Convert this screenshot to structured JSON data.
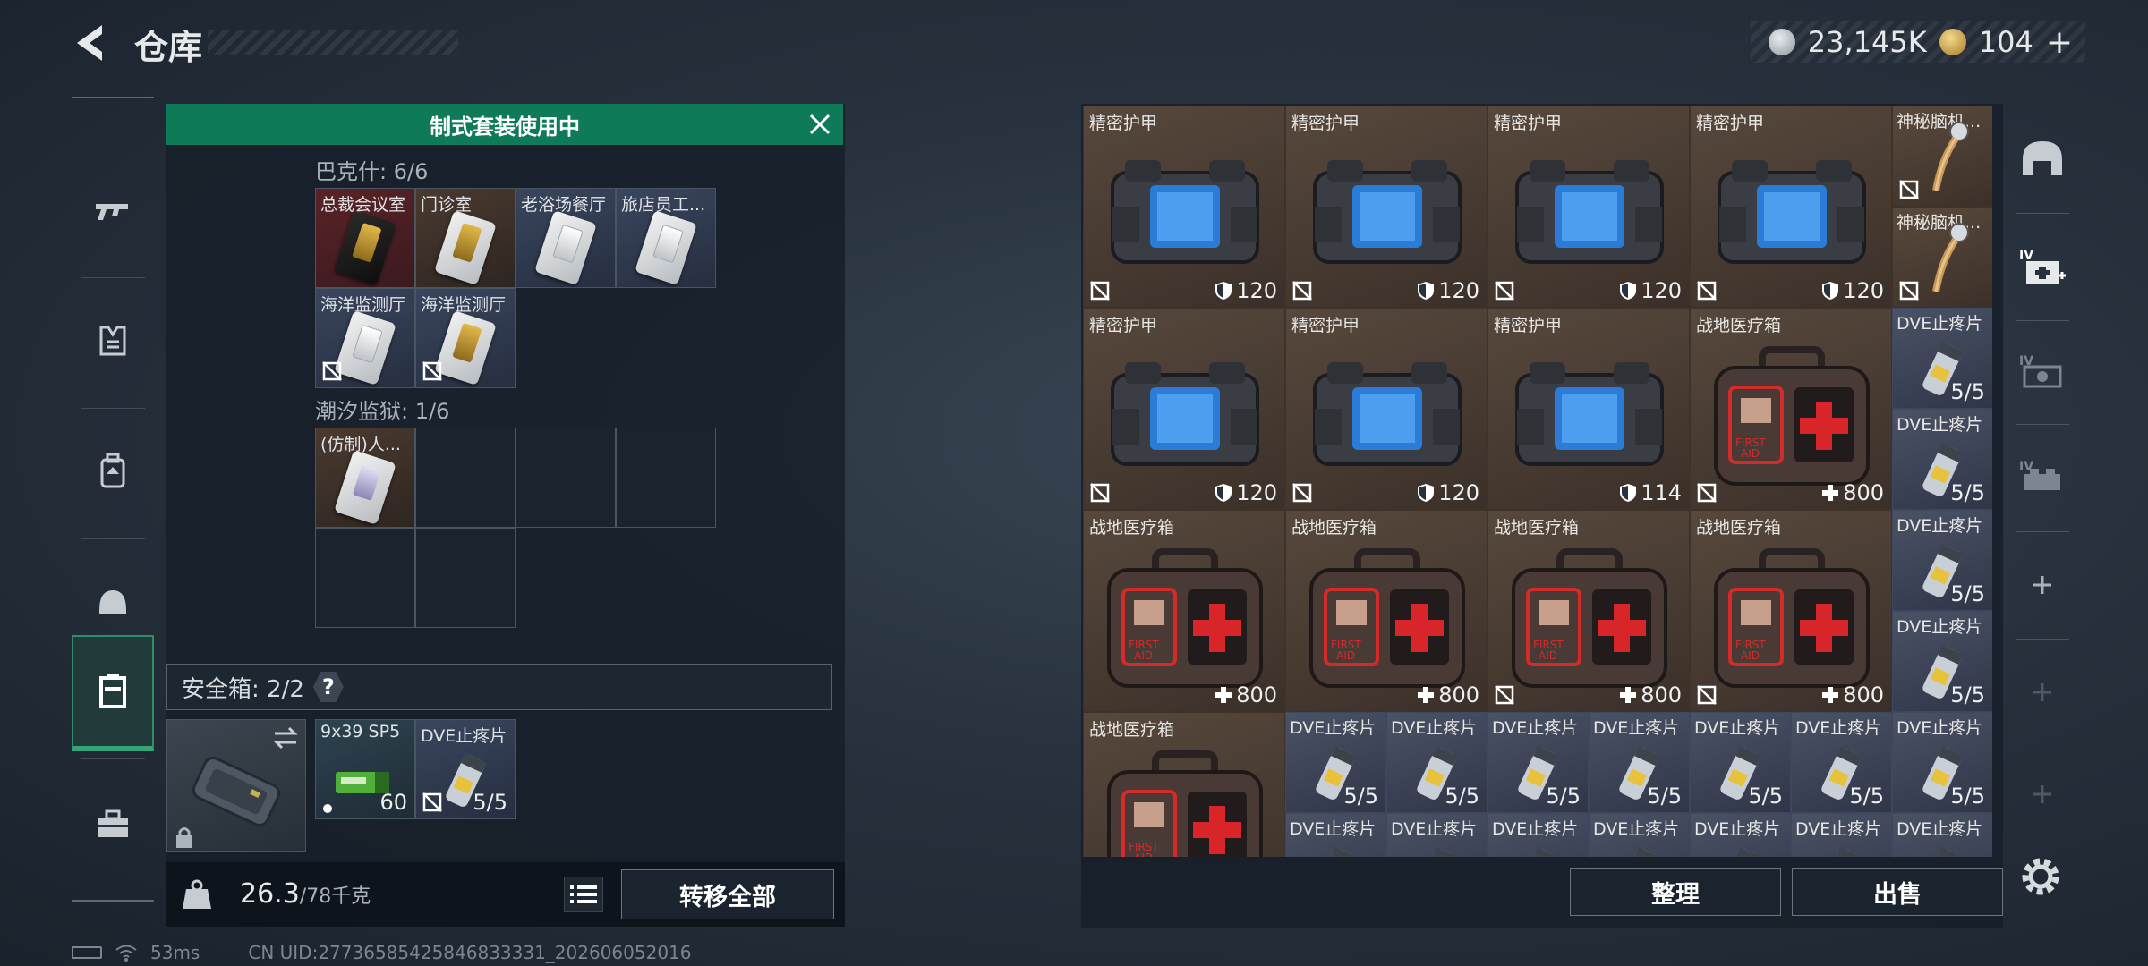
{
  "header": {
    "title": "仓库"
  },
  "currency": {
    "silver": "23,145K",
    "gold": "104"
  },
  "kit_banner": "制式套装使用中",
  "sections": [
    {
      "label": "巴克什: 6/6",
      "items": [
        {
          "name": "总裁会议室",
          "style": "red",
          "card": "blk",
          "noreturn": false
        },
        {
          "name": "门诊室",
          "style": "brown",
          "card": "gold",
          "noreturn": false
        },
        {
          "name": "老浴场餐厅",
          "style": "blue",
          "card": "white",
          "noreturn": false
        },
        {
          "name": "旅店员工...",
          "style": "blue",
          "card": "white",
          "noreturn": false
        },
        {
          "name": "海洋监测厅",
          "style": "blue",
          "card": "white",
          "noreturn": true
        },
        {
          "name": "海洋监测厅",
          "style": "blue",
          "card": "gold",
          "noreturn": true
        }
      ]
    },
    {
      "label": "潮汐监狱: 1/6",
      "items": [
        {
          "name": "(仿制)人...",
          "style": "brown",
          "card": "lav",
          "noreturn": false
        }
      ]
    }
  ],
  "safe_box": {
    "label": "安全箱: 2/2",
    "help": "?",
    "items": [
      {
        "name": "9x39 SP5",
        "count": "60"
      },
      {
        "name": "DVE止疼片",
        "count": "5/5"
      }
    ]
  },
  "weight": {
    "current": "26.3",
    "max": "/78千克"
  },
  "buttons": {
    "transfer_all": "转移全部",
    "organize": "整理",
    "sell": "出售"
  },
  "status": {
    "ping": "53ms",
    "uid": "CN UID:27736585425846833331_202606052016"
  },
  "storage": {
    "big_items": [
      {
        "name": "精密护甲",
        "type": "armor",
        "value": "120",
        "stat": "shield",
        "noreturn": true
      },
      {
        "name": "精密护甲",
        "type": "armor",
        "value": "120",
        "stat": "shield",
        "noreturn": true
      },
      {
        "name": "精密护甲",
        "type": "armor",
        "value": "120",
        "stat": "shield",
        "noreturn": true
      },
      {
        "name": "精密护甲",
        "type": "armor",
        "value": "120",
        "stat": "shield",
        "noreturn": true
      },
      {
        "name": "精密护甲",
        "type": "armor",
        "value": "120",
        "stat": "shield",
        "noreturn": true
      },
      {
        "name": "精密护甲",
        "type": "armor",
        "value": "120",
        "stat": "shield",
        "noreturn": true
      },
      {
        "name": "精密护甲",
        "type": "armor",
        "value": "114",
        "stat": "shield",
        "noreturn": false
      },
      {
        "name": "战地医疗箱",
        "type": "med",
        "value": "800",
        "stat": "plus",
        "noreturn": true
      },
      {
        "name": "战地医疗箱",
        "type": "med",
        "value": "800",
        "stat": "plus",
        "noreturn": false
      },
      {
        "name": "战地医疗箱",
        "type": "med",
        "value": "800",
        "stat": "plus",
        "noreturn": false
      },
      {
        "name": "战地医疗箱",
        "type": "med",
        "value": "800",
        "stat": "plus",
        "noreturn": true
      },
      {
        "name": "战地医疗箱",
        "type": "med",
        "value": "800",
        "stat": "plus",
        "noreturn": true
      },
      {
        "name": "战地医疗箱",
        "type": "med",
        "value": "",
        "stat": "",
        "noreturn": false
      }
    ],
    "small_items": [
      {
        "name": "神秘脑机...",
        "count": "",
        "type": "wire",
        "noreturn": true
      },
      {
        "name": "神秘脑机...",
        "count": "",
        "type": "wire",
        "noreturn": true
      },
      {
        "name": "DVE止疼片",
        "count": "5/5",
        "type": "pill",
        "noreturn": false
      },
      {
        "name": "DVE止疼片",
        "count": "5/5",
        "type": "pill",
        "noreturn": false
      },
      {
        "name": "DVE止疼片",
        "count": "5/5",
        "type": "pill",
        "noreturn": false
      },
      {
        "name": "DVE止疼片",
        "count": "5/5",
        "type": "pill",
        "noreturn": false
      },
      {
        "name": "DVE止疼片",
        "count": "5/5",
        "type": "pill",
        "noreturn": false
      },
      {
        "name": "DVE止疼片",
        "count": "5/5",
        "type": "pill",
        "noreturn": false
      },
      {
        "name": "DVE止疼片",
        "count": "5/5",
        "type": "pill",
        "noreturn": false
      },
      {
        "name": "DVE止疼片",
        "count": "5/5",
        "type": "pill",
        "noreturn": false
      },
      {
        "name": "DVE止疼片",
        "count": "5/5",
        "type": "pill",
        "noreturn": false
      },
      {
        "name": "DVE止疼片",
        "count": "5/5",
        "type": "pill",
        "noreturn": false
      },
      {
        "name": "DVE止疼片",
        "count": "5/5",
        "type": "pill",
        "noreturn": false
      },
      {
        "name": "DVE止疼片",
        "count": "5/5",
        "type": "pill",
        "noreturn": false
      },
      {
        "name": "DVE止疼片",
        "count": "",
        "type": "pill",
        "noreturn": false
      },
      {
        "name": "DVE止疼片",
        "count": "",
        "type": "pill",
        "noreturn": false
      },
      {
        "name": "DVE止疼片",
        "count": "",
        "type": "pill",
        "noreturn": false
      },
      {
        "name": "DVE止疼片",
        "count": "",
        "type": "pill",
        "noreturn": false
      },
      {
        "name": "DVE止疼片",
        "count": "",
        "type": "pill",
        "noreturn": false
      },
      {
        "name": "DVE止疼片",
        "count": "",
        "type": "pill",
        "noreturn": false
      },
      {
        "name": "DVE止疼片",
        "count": "",
        "type": "pill",
        "noreturn": false
      }
    ]
  },
  "left_nav": [
    "weapon-icon",
    "armor-vest-icon",
    "backpack-icon",
    "helmet-icon",
    "container-icon",
    "toolbox-icon"
  ],
  "right_nav": [
    "helmet-slot-icon",
    "medkit-slot-icon",
    "armor-slot-icon",
    "rig-slot-icon",
    "add-icon",
    "add-icon",
    "add-icon"
  ]
}
